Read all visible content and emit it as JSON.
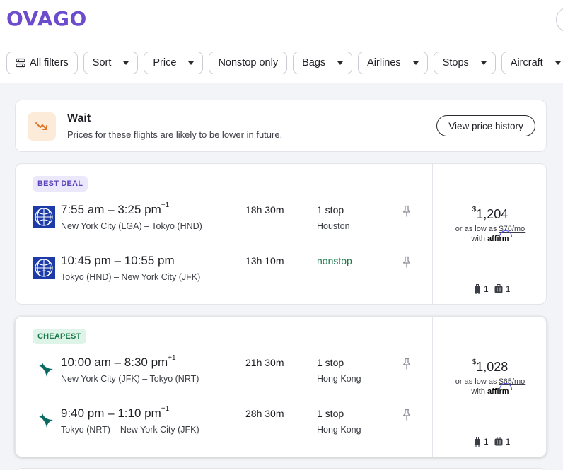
{
  "brand": {
    "logo_text": "OVAGO",
    "color": "#6c4ccc"
  },
  "filters": [
    {
      "label": "All filters",
      "icon": "filter-icon",
      "caret": false
    },
    {
      "label": "Sort",
      "caret": true
    },
    {
      "label": "Price",
      "caret": true
    },
    {
      "label": "Nonstop only",
      "caret": false
    },
    {
      "label": "Bags",
      "caret": true
    },
    {
      "label": "Airlines",
      "caret": true
    },
    {
      "label": "Stops",
      "caret": true
    },
    {
      "label": "Aircraft",
      "caret": true
    }
  ],
  "advice": {
    "title": "Wait",
    "subtitle": "Prices for these flights are likely to be lower in future.",
    "button": "View price history",
    "icon": "trend-down-icon"
  },
  "results": [
    {
      "badge": "BEST DEAL",
      "legs": [
        {
          "airline_icon": "united-globe-icon",
          "times": "7:55 am – 3:25 pm",
          "day_offset": "+1",
          "route": "New York City (LGA) – Tokyo (HND)",
          "duration": "18h 30m",
          "stops": "1 stop",
          "via": "Houston"
        },
        {
          "airline_icon": "united-globe-icon",
          "times": "10:45 pm – 10:55 pm",
          "day_offset": "",
          "route": "Tokyo (HND) – New York City (JFK)",
          "duration": "13h 10m",
          "stops": "nonstop",
          "via": ""
        }
      ],
      "price_currency": "$",
      "price": "1,204",
      "monthly_prefix": "or as low as",
      "monthly_amount": "$76/mo",
      "affirm_prefix": "with",
      "affirm_brand": "affirm",
      "carry_on": "1",
      "checked": "1"
    },
    {
      "badge": "CHEAPEST",
      "legs": [
        {
          "airline_icon": "cathay-wing-icon",
          "times": "10:00 am – 8:30 pm",
          "day_offset": "+1",
          "route": "New York City (JFK) – Tokyo (NRT)",
          "duration": "21h 30m",
          "stops": "1 stop",
          "via": "Hong Kong"
        },
        {
          "airline_icon": "cathay-wing-icon",
          "times": "9:40 pm – 1:10 pm",
          "day_offset": "+1",
          "route": "Tokyo (NRT) – New York City (JFK)",
          "duration": "28h 30m",
          "stops": "1 stop",
          "via": "Hong Kong"
        }
      ],
      "price_currency": "$",
      "price": "1,028",
      "monthly_prefix": "or as low as",
      "monthly_amount": "$65/mo",
      "affirm_prefix": "with",
      "affirm_brand": "affirm",
      "carry_on": "1",
      "checked": "1"
    }
  ],
  "colors": {
    "accent": "#6c4ccc",
    "nonstop": "#1c7a4a",
    "united_blue": "#1c3ba8",
    "cathay_green": "#0b6b63",
    "wait_orange": "#e0762a"
  }
}
